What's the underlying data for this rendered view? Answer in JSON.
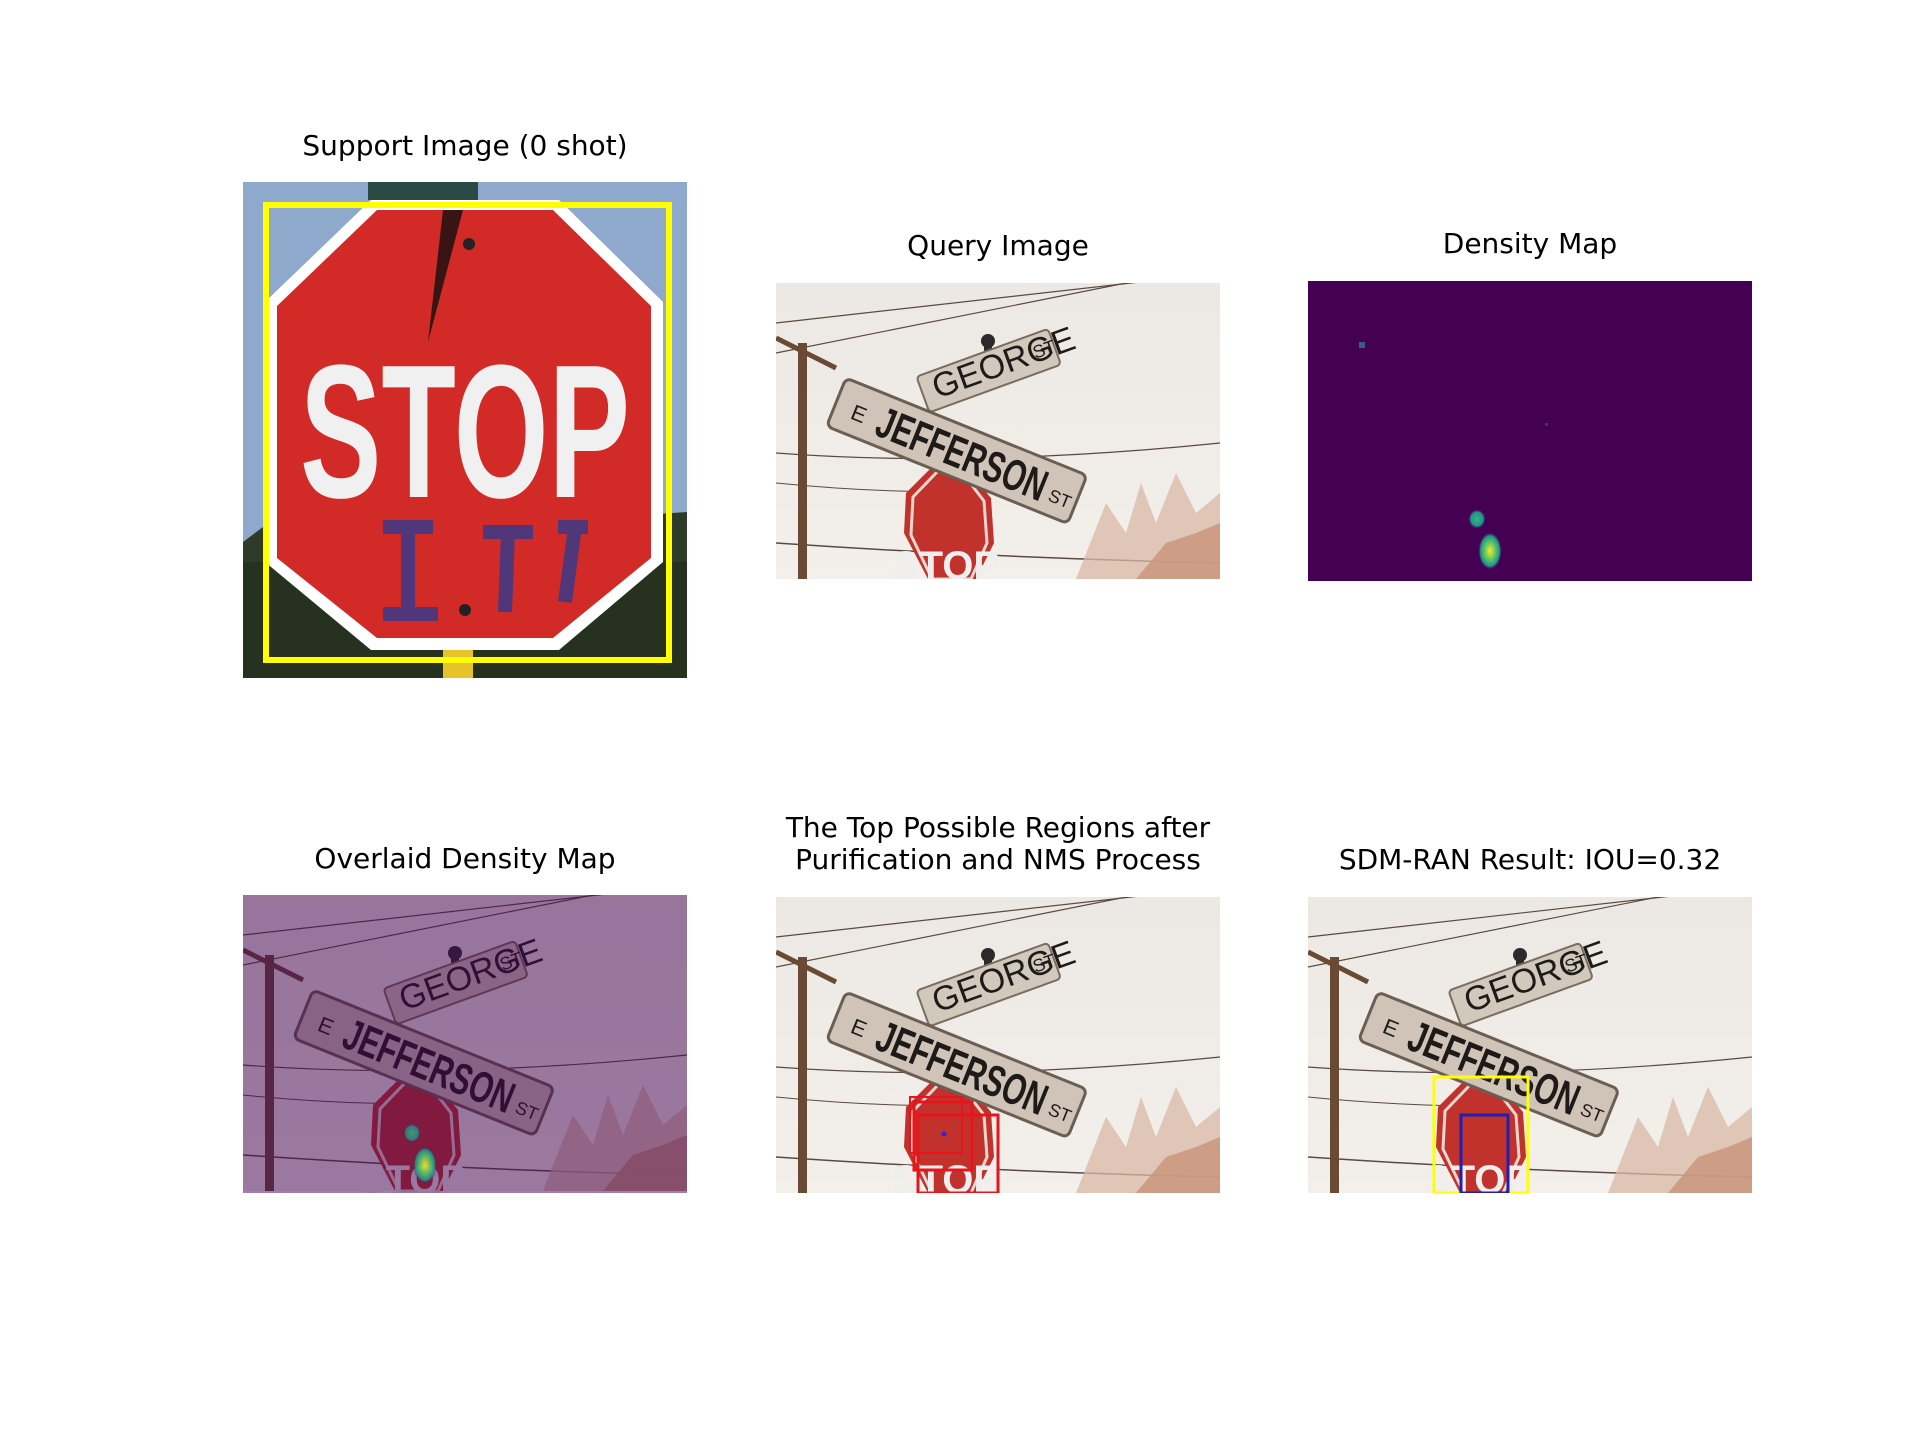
{
  "panels": {
    "support": {
      "title": "Support Image (0 shot)",
      "sign_text": "STOP"
    },
    "query": {
      "title": "Query Image"
    },
    "density": {
      "title": "Density Map"
    },
    "overlaid": {
      "title": "Overlaid Density Map"
    },
    "regions": {
      "title": "The Top Possible Regions after\nPurification and NMS Process"
    },
    "result": {
      "title": "SDM-RAN Result: IOU=0.32"
    }
  },
  "street_signs": {
    "upper": "GEORGE",
    "upper_suffix": "ST",
    "lower_prefix": "E",
    "lower": "JEFFERSON",
    "lower_suffix": "ST",
    "stop": "STOP"
  },
  "colors": {
    "viridis_bg": "#440154",
    "support_box": "#ffff00",
    "proposal_box": "#e8141c",
    "pred_box": "#2020b0",
    "gt_box": "#ffff00"
  }
}
